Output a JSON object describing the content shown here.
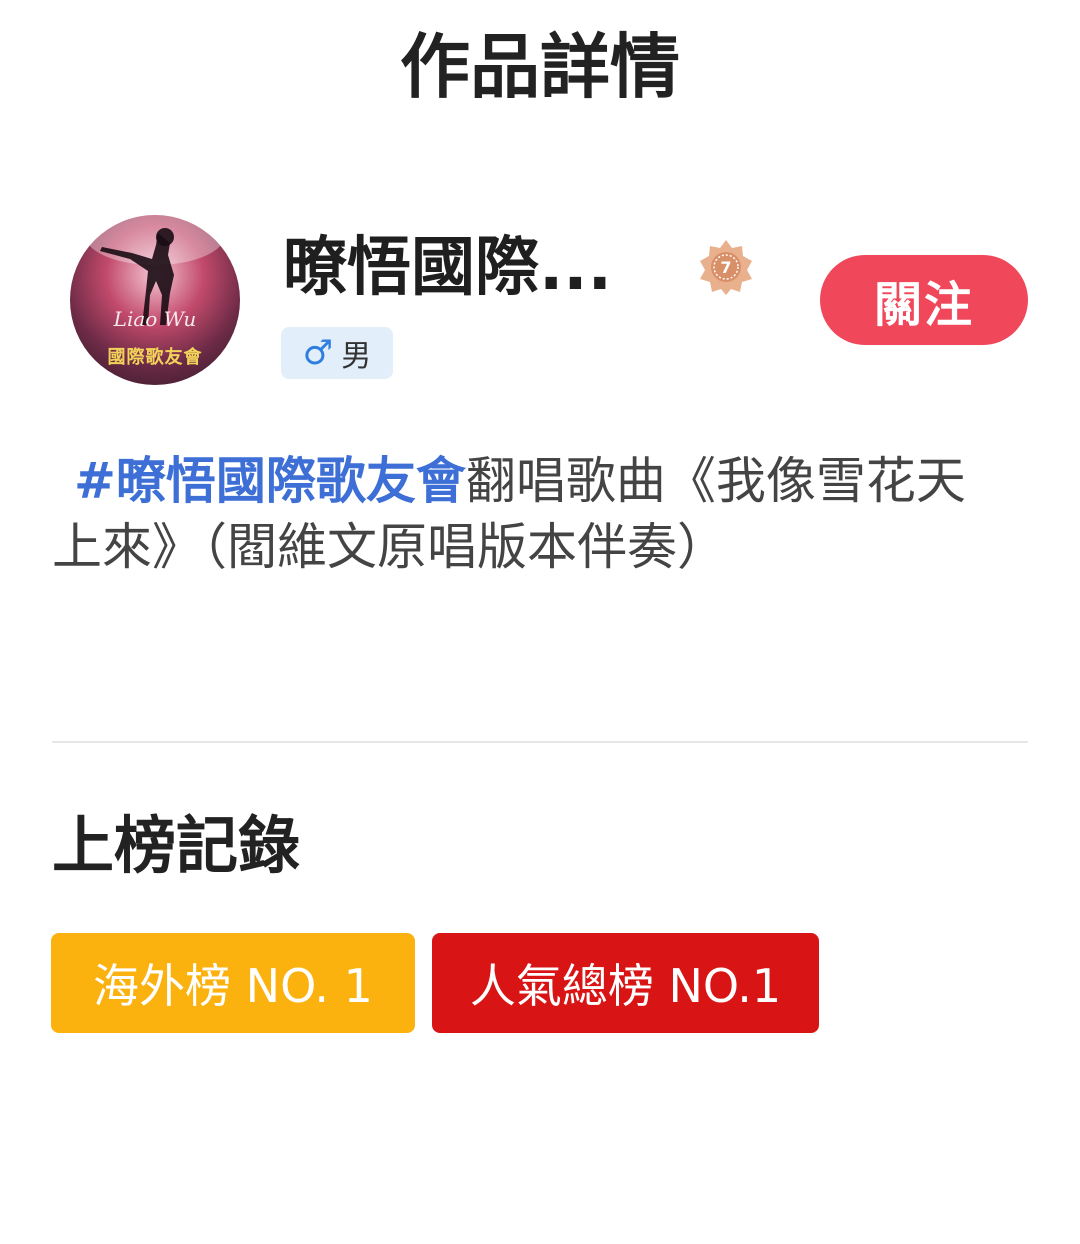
{
  "header": {
    "title": "作品詳情"
  },
  "profile": {
    "avatar_signature": "Liao Wu",
    "avatar_caption": "國際歌友會",
    "username": "暸悟國際...",
    "level": "7",
    "gender_label": "男",
    "gender_icon": "♂",
    "follow_label": "關注"
  },
  "work": {
    "hashtag": "#暸悟國際歌友會",
    "description": "翻唱歌曲《我像雪花天上來》（閻維文原唱版本伴奏）"
  },
  "rankings": {
    "title": "上榜記錄",
    "badges": [
      {
        "label": "海外榜 NO. 1",
        "color": "#fbb20f"
      },
      {
        "label": "人氣總榜 NO.1",
        "color": "#d81414"
      }
    ]
  },
  "colors": {
    "follow_button": "#f0475a",
    "hashtag": "#3d6fd6",
    "gender_tag_bg": "#e3eefb"
  }
}
